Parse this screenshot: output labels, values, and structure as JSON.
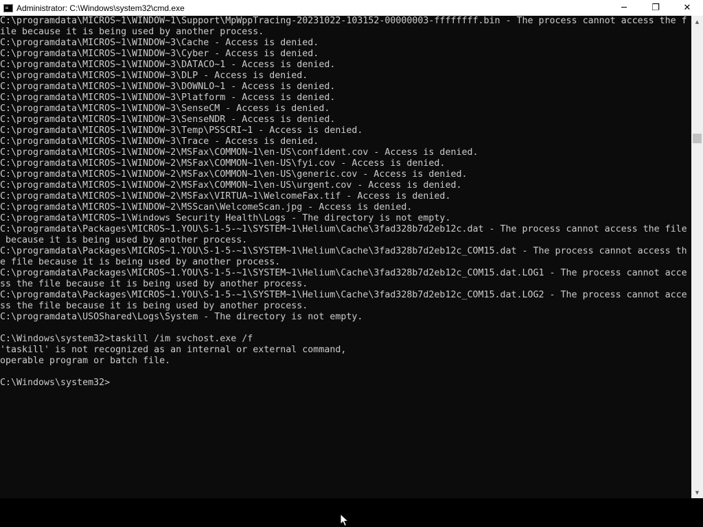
{
  "window": {
    "title": "Administrator: C:\\Windows\\system32\\cmd.exe",
    "minimize_icon": "minimize-icon",
    "maximize_icon": "restore-icon",
    "close_icon": "close-icon",
    "min_glyph": "─",
    "max_glyph": "❐",
    "close_glyph": "✕"
  },
  "console": {
    "text_color": "#cccccc",
    "background": "#0c0c0c",
    "lines": [
      "C:\\programdata\\MICROS~1\\WINDOW~1\\Support\\MpWppTracing-20231022-103152-00000003-ffffffff.bin - The process cannot access the f",
      "ile because it is being used by another process.",
      "C:\\programdata\\MICROS~1\\WINDOW~3\\Cache - Access is denied.",
      "C:\\programdata\\MICROS~1\\WINDOW~3\\Cyber - Access is denied.",
      "C:\\programdata\\MICROS~1\\WINDOW~3\\DATACO~1 - Access is denied.",
      "C:\\programdata\\MICROS~1\\WINDOW~3\\DLP - Access is denied.",
      "C:\\programdata\\MICROS~1\\WINDOW~3\\DOWNLO~1 - Access is denied.",
      "C:\\programdata\\MICROS~1\\WINDOW~3\\Platform - Access is denied.",
      "C:\\programdata\\MICROS~1\\WINDOW~3\\SenseCM - Access is denied.",
      "C:\\programdata\\MICROS~1\\WINDOW~3\\SenseNDR - Access is denied.",
      "C:\\programdata\\MICROS~1\\WINDOW~3\\Temp\\PSSCRI~1 - Access is denied.",
      "C:\\programdata\\MICROS~1\\WINDOW~3\\Trace - Access is denied.",
      "C:\\programdata\\MICROS~1\\WINDOW~2\\MSFax\\COMMON~1\\en-US\\confident.cov - Access is denied.",
      "C:\\programdata\\MICROS~1\\WINDOW~2\\MSFax\\COMMON~1\\en-US\\fyi.cov - Access is denied.",
      "C:\\programdata\\MICROS~1\\WINDOW~2\\MSFax\\COMMON~1\\en-US\\generic.cov - Access is denied.",
      "C:\\programdata\\MICROS~1\\WINDOW~2\\MSFax\\COMMON~1\\en-US\\urgent.cov - Access is denied.",
      "C:\\programdata\\MICROS~1\\WINDOW~2\\MSFax\\VIRTUA~1\\WelcomeFax.tif - Access is denied.",
      "C:\\programdata\\MICROS~1\\WINDOW~2\\MSScan\\WelcomeScan.jpg - Access is denied.",
      "C:\\programdata\\MICROS~1\\Windows Security Health\\Logs - The directory is not empty.",
      "C:\\programdata\\Packages\\MICROS~1.YOU\\S-1-5-~1\\SYSTEM~1\\Helium\\Cache\\3fad328b7d2eb12c.dat - The process cannot access the file",
      " because it is being used by another process.",
      "C:\\programdata\\Packages\\MICROS~1.YOU\\S-1-5-~1\\SYSTEM~1\\Helium\\Cache\\3fad328b7d2eb12c_COM15.dat - The process cannot access th",
      "e file because it is being used by another process.",
      "C:\\programdata\\Packages\\MICROS~1.YOU\\S-1-5-~1\\SYSTEM~1\\Helium\\Cache\\3fad328b7d2eb12c_COM15.dat.LOG1 - The process cannot acce",
      "ss the file because it is being used by another process.",
      "C:\\programdata\\Packages\\MICROS~1.YOU\\S-1-5-~1\\SYSTEM~1\\Helium\\Cache\\3fad328b7d2eb12c_COM15.dat.LOG2 - The process cannot acce",
      "ss the file because it is being used by another process.",
      "C:\\programdata\\USOShared\\Logs\\System - The directory is not empty.",
      "",
      "C:\\Windows\\system32>taskill /im svchost.exe /f",
      "'taskill' is not recognized as an internal or external command,",
      "operable program or batch file.",
      "",
      "C:\\Windows\\system32>"
    ]
  },
  "scrollbar": {
    "up_icon": "scroll-up-arrow-icon",
    "down_icon": "scroll-down-arrow-icon",
    "up_glyph": "▲",
    "down_glyph": "▼"
  },
  "cursor": {
    "icon": "mouse-pointer-icon"
  }
}
